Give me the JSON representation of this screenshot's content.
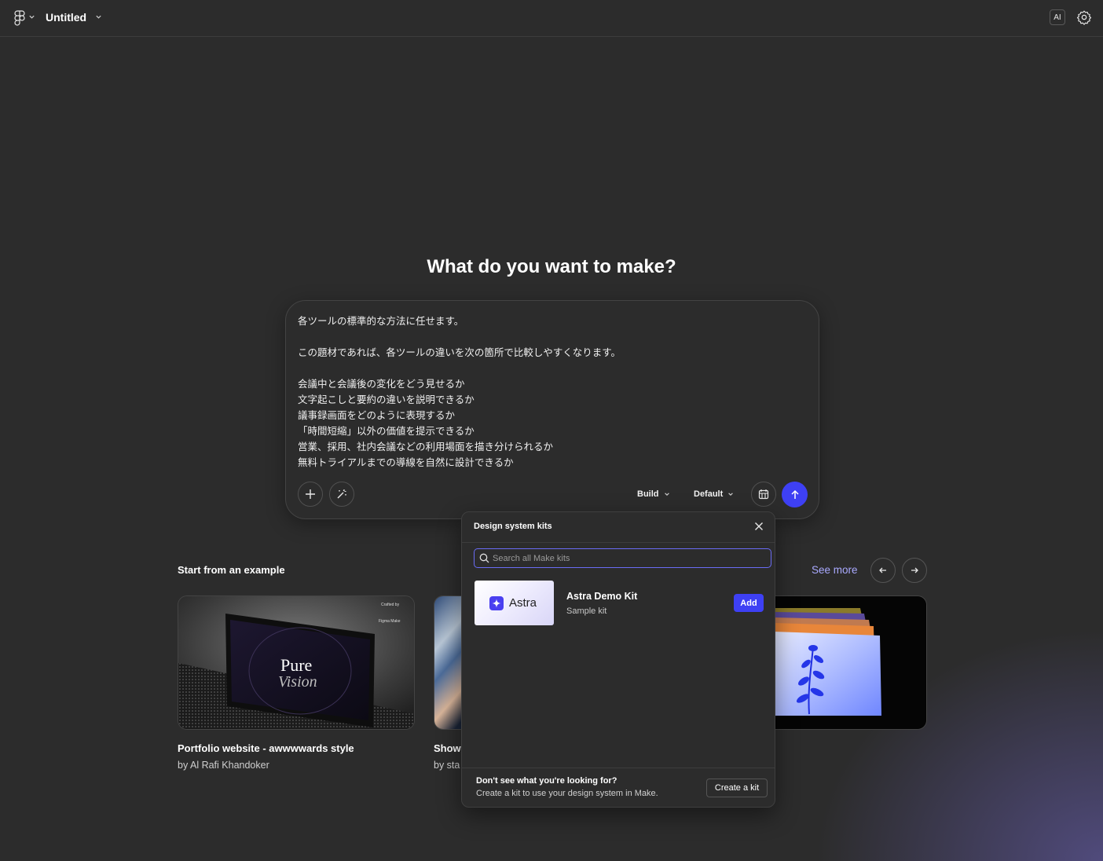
{
  "topbar": {
    "file_title": "Untitled",
    "ai_badge": "AI",
    "icons": [
      "figma-logo-icon",
      "chevron-down-icon",
      "gear-icon"
    ]
  },
  "main": {
    "headline": "What do you want to make?",
    "prompt": {
      "text": "各ツールの標準的な方法に任せます。\n\nこの題材であれば、各ツールの違いを次の箇所で比較しやすくなります。\n\n会議中と会議後の変化をどう見せるか\n文字起こしと要約の違いを説明できるか\n議事録画面をどのように表現するか\n「時間短縮」以外の価値を提示できるか\n営業、採用、社内会議などの利用場面を描き分けられるか\n無料トライアルまでの導線を自然に設計できるか",
      "mode_label": "Build",
      "style_label": "Default",
      "accent": "#3e40f4"
    }
  },
  "examples": {
    "heading": "Start from an example",
    "see_more": "See more",
    "cards": [
      {
        "title": "Portfolio website - awwwwards style",
        "author": "by Al Rafi Khandoker",
        "thumb_text_1": "Pure",
        "thumb_text_2": "Vision",
        "thumb_small_1": "Crafted by",
        "thumb_small_2": "Figma Make"
      },
      {
        "title": "Show",
        "author": "by sta"
      },
      {
        "title": "",
        "author": ""
      }
    ]
  },
  "popover": {
    "title": "Design system kits",
    "search_placeholder": "Search all Make kits",
    "kits": [
      {
        "thumb_label": "Astra",
        "name": "Astra Demo Kit",
        "subtitle": "Sample kit",
        "action": "Add"
      }
    ],
    "footer_question": "Don't see what you're looking for?",
    "footer_sub": "Create a kit to use your design system in Make.",
    "create_button": "Create a kit"
  }
}
